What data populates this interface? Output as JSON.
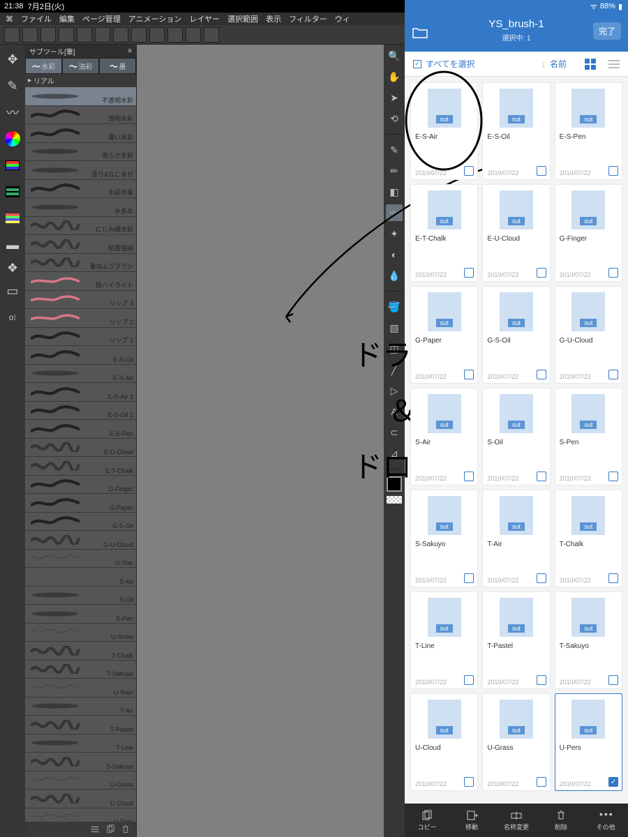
{
  "status": {
    "time": "21:38",
    "date": "7月2日(火)",
    "battery": "88%"
  },
  "menu": [
    "ファイル",
    "編集",
    "ページ管理",
    "アニメーション",
    "レイヤー",
    "選択範囲",
    "表示",
    "フィルター",
    "ウィ"
  ],
  "subtool": {
    "title": "サブツール[筆]",
    "tabs": [
      "水彩",
      "油彩",
      "墨"
    ],
    "sub": "リアル",
    "brushes": [
      {
        "n": "不透明水彩",
        "t": "soft",
        "sel": true
      },
      {
        "n": "透明水彩",
        "t": "wave"
      },
      {
        "n": "濃い水彩",
        "t": "wave"
      },
      {
        "n": "滑らか水彩",
        "t": "soft"
      },
      {
        "n": "塗り&なじませ",
        "t": "soft"
      },
      {
        "n": "水彩毛筆",
        "t": "wave"
      },
      {
        "n": "水多め",
        "t": "soft"
      },
      {
        "n": "にじみ縁水彩",
        "t": "rough"
      },
      {
        "n": "紙質強調",
        "t": "rough"
      },
      {
        "n": "重ねムラブラシ",
        "t": "rough"
      },
      {
        "n": "唇ハイライト",
        "t": "pink"
      },
      {
        "n": "リップ 3",
        "t": "pink"
      },
      {
        "n": "リップ 2",
        "t": "pink"
      },
      {
        "n": "リップ 1",
        "t": "wave"
      },
      {
        "n": "E-S-Oil",
        "t": "wave"
      },
      {
        "n": "E-S-Air",
        "t": "soft"
      },
      {
        "n": "E-S-Air 2",
        "t": "wave"
      },
      {
        "n": "E-S-Oil 2",
        "t": "wave"
      },
      {
        "n": "E-S-Pen",
        "t": "wave"
      },
      {
        "n": "E-U-Cloud",
        "t": "rough"
      },
      {
        "n": "E-T-Chalk",
        "t": "rough"
      },
      {
        "n": "G-Finger",
        "t": "wave"
      },
      {
        "n": "G-Paper",
        "t": "wave"
      },
      {
        "n": "G-S-Oil",
        "t": "wave"
      },
      {
        "n": "G-U-Cloud",
        "t": "rough"
      },
      {
        "n": "U-Star",
        "t": "dots"
      },
      {
        "n": "S-Air",
        "t": "none"
      },
      {
        "n": "S-Oil",
        "t": "soft"
      },
      {
        "n": "S-Pen",
        "t": "soft"
      },
      {
        "n": "U-Snow",
        "t": "dots"
      },
      {
        "n": "T-Chalk",
        "t": "rough"
      },
      {
        "n": "T-Sakuyo",
        "t": "rough"
      },
      {
        "n": "U-Rain",
        "t": "dots"
      },
      {
        "n": "T-Air",
        "t": "soft"
      },
      {
        "n": "T-Pastel",
        "t": "rough"
      },
      {
        "n": "T-Line",
        "t": "soft"
      },
      {
        "n": "S-Sakuyo",
        "t": "rough"
      },
      {
        "n": "U-Grass",
        "t": "dots"
      },
      {
        "n": "U-Cloud",
        "t": "rough"
      },
      {
        "n": "U-Pers",
        "t": "dots"
      }
    ]
  },
  "handwriting": [
    "ドラッグ",
    "＆",
    "ドロップ"
  ],
  "files": {
    "title": "YS_brush-1",
    "subtitle": "選択中: 1",
    "done": "完了",
    "selectall": "すべてを選択",
    "sort": "名前",
    "ext": "sut",
    "items": [
      {
        "n": "E-S-Air",
        "d": "2010/07/22",
        "circled": true
      },
      {
        "n": "E-S-Oil",
        "d": "2010/07/22"
      },
      {
        "n": "E-S-Pen",
        "d": "2010/07/22"
      },
      {
        "n": "E-T-Chalk",
        "d": "2010/07/22"
      },
      {
        "n": "E-U-Cloud",
        "d": "2010/07/22"
      },
      {
        "n": "G-Finger",
        "d": "2010/07/22"
      },
      {
        "n": "G-Paper",
        "d": "2010/07/22"
      },
      {
        "n": "G-S-Oil",
        "d": "2010/07/22"
      },
      {
        "n": "G-U-Cloud",
        "d": "2010/07/22"
      },
      {
        "n": "S-Air",
        "d": "2010/07/22"
      },
      {
        "n": "S-Oil",
        "d": "2010/07/22"
      },
      {
        "n": "S-Pen",
        "d": "2010/07/22"
      },
      {
        "n": "S-Sakuyo",
        "d": "2010/07/22"
      },
      {
        "n": "T-Air",
        "d": "2010/07/22"
      },
      {
        "n": "T-Chalk",
        "d": "2010/07/22"
      },
      {
        "n": "T-Line",
        "d": "2010/07/22"
      },
      {
        "n": "T-Pastel",
        "d": "2010/07/22"
      },
      {
        "n": "T-Sakuyo",
        "d": "2010/07/22"
      },
      {
        "n": "U-Cloud",
        "d": "2010/07/22"
      },
      {
        "n": "U-Grass",
        "d": "2010/07/22"
      },
      {
        "n": "U-Pers",
        "d": "2010/07/22",
        "sel": true
      }
    ],
    "bottom": [
      "コピー",
      "移動",
      "名称変更",
      "削除",
      "その他"
    ]
  }
}
